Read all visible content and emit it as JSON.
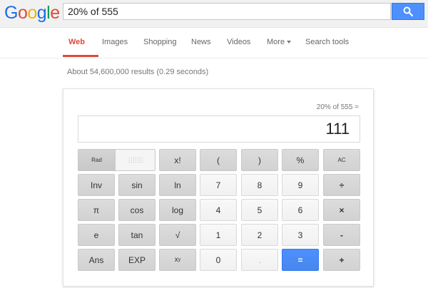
{
  "header": {
    "logo_letters": [
      "G",
      "o",
      "o",
      "g",
      "l",
      "e"
    ],
    "logo_colors": [
      "#1a6ee8",
      "#dd4b39",
      "#f4b400",
      "#1a6ee8",
      "#0f9d58",
      "#dd4b39"
    ],
    "search_value": "20% of 555",
    "search_icon": "magnifier-icon"
  },
  "nav": {
    "tabs": [
      "Web",
      "Images",
      "Shopping",
      "News",
      "Videos",
      "More",
      "Search tools"
    ],
    "active": "Web",
    "accent": "#dd4b39"
  },
  "results_info": "About 54,600,000 results (0.29 seconds)",
  "calculator": {
    "expression": "20% of 555 =",
    "result": "111",
    "rad_label": "Rad",
    "rows": [
      [
        "x!",
        "(",
        ")",
        "%",
        "AC"
      ],
      [
        "Inv",
        "sin",
        "ln",
        "7",
        "8",
        "9",
        "÷"
      ],
      [
        "π",
        "cos",
        "log",
        "4",
        "5",
        "6",
        "×"
      ],
      [
        "e",
        "tan",
        "√",
        "1",
        "2",
        "3",
        "-"
      ],
      [
        "Ans",
        "EXP",
        "xʸ",
        "0",
        ".",
        "=",
        "+"
      ]
    ],
    "xy_base": "x",
    "xy_exp": "y",
    "equals_color": "#4d90fe"
  }
}
